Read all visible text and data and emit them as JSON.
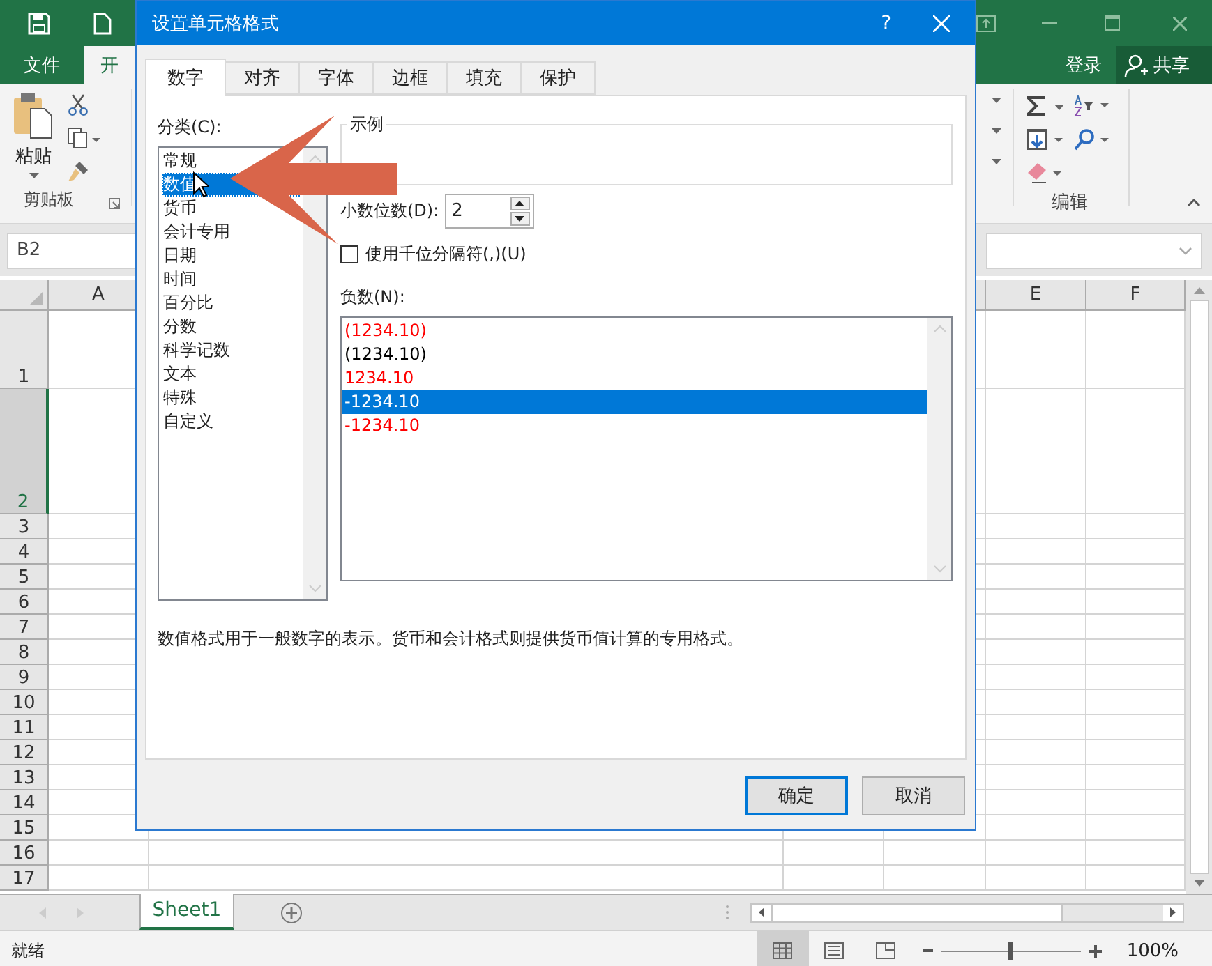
{
  "excel": {
    "file_tab": "文件",
    "tabs": [
      {
        "label": "开",
        "selected": true
      }
    ],
    "sign_in": "登录",
    "share": "共享",
    "clipboard": {
      "paste": "粘贴",
      "group": "剪贴板"
    },
    "editing_group": "编辑",
    "name_box": "B2",
    "columns": [
      "A",
      "E",
      "F"
    ],
    "rows": [
      {
        "label": "1",
        "selected": false
      },
      {
        "label": "2",
        "selected": true
      },
      {
        "label": "3",
        "selected": false
      },
      {
        "label": "4",
        "selected": false
      },
      {
        "label": "5",
        "selected": false
      },
      {
        "label": "6",
        "selected": false
      },
      {
        "label": "7",
        "selected": false
      },
      {
        "label": "8",
        "selected": false
      },
      {
        "label": "9",
        "selected": false
      },
      {
        "label": "10",
        "selected": false
      },
      {
        "label": "11",
        "selected": false
      },
      {
        "label": "12",
        "selected": false
      },
      {
        "label": "13",
        "selected": false
      },
      {
        "label": "14",
        "selected": false
      },
      {
        "label": "15",
        "selected": false
      },
      {
        "label": "16",
        "selected": false
      },
      {
        "label": "17",
        "selected": false
      }
    ],
    "sheet_tabs": [
      {
        "label": "Sheet1",
        "selected": true
      }
    ],
    "status": "就绪",
    "zoom": "100%",
    "zoom_slider": {
      "level": 0.48
    }
  },
  "dialog": {
    "title": "设置单元格格式",
    "help": "?",
    "tabs": [
      {
        "label": "数字",
        "selected": true
      },
      {
        "label": "对齐",
        "selected": false
      },
      {
        "label": "字体",
        "selected": false
      },
      {
        "label": "边框",
        "selected": false
      },
      {
        "label": "填充",
        "selected": false
      },
      {
        "label": "保护",
        "selected": false
      }
    ],
    "category_label": "分类(C):",
    "categories": [
      {
        "label": "常规",
        "selected": false
      },
      {
        "label": "数值",
        "selected": true
      },
      {
        "label": "货币",
        "selected": false
      },
      {
        "label": "会计专用",
        "selected": false
      },
      {
        "label": "日期",
        "selected": false
      },
      {
        "label": "时间",
        "selected": false
      },
      {
        "label": "百分比",
        "selected": false
      },
      {
        "label": "分数",
        "selected": false
      },
      {
        "label": "科学记数",
        "selected": false
      },
      {
        "label": "文本",
        "selected": false
      },
      {
        "label": "特殊",
        "selected": false
      },
      {
        "label": "自定义",
        "selected": false
      }
    ],
    "sample_label": "示例",
    "decimal_label": "小数位数(D):",
    "decimal_value": "2",
    "thousands": {
      "label": "使用千位分隔符(,)(U)",
      "checked": false
    },
    "negative_label": "负数(N):",
    "negatives": [
      {
        "label": "(1234.10)",
        "color": "#ff0000",
        "selected": false
      },
      {
        "label": "(1234.10)",
        "color": "#000000",
        "selected": false
      },
      {
        "label": "1234.10",
        "color": "#ff0000",
        "selected": false
      },
      {
        "label": "-1234.10",
        "selected": true
      },
      {
        "label": "-1234.10",
        "color": "#ff0000",
        "selected": false
      }
    ],
    "description": "数值格式用于一般数字的表示。货币和会计格式则提供货币值计算的专用格式。",
    "buttons": [
      {
        "label": "确定",
        "default": true
      },
      {
        "label": "取消",
        "default": false
      }
    ]
  }
}
